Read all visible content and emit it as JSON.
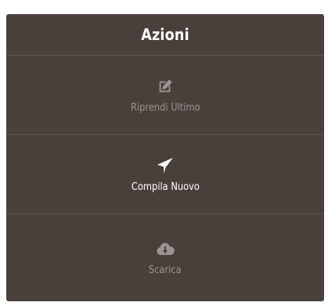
{
  "panel": {
    "title": "Azioni",
    "actions": [
      {
        "label": "Riprendi Ultimo",
        "icon": "edit-icon",
        "state": "muted"
      },
      {
        "label": "Compila Nuovo",
        "icon": "send-icon",
        "state": "active"
      },
      {
        "label": "Scarica",
        "icon": "cloud-download-icon",
        "state": "muted"
      }
    ]
  },
  "colors": {
    "panel_bg": "#4a403b",
    "divider": "#5e5450",
    "muted_text": "#9c9592",
    "active_text": "#ffffff"
  }
}
